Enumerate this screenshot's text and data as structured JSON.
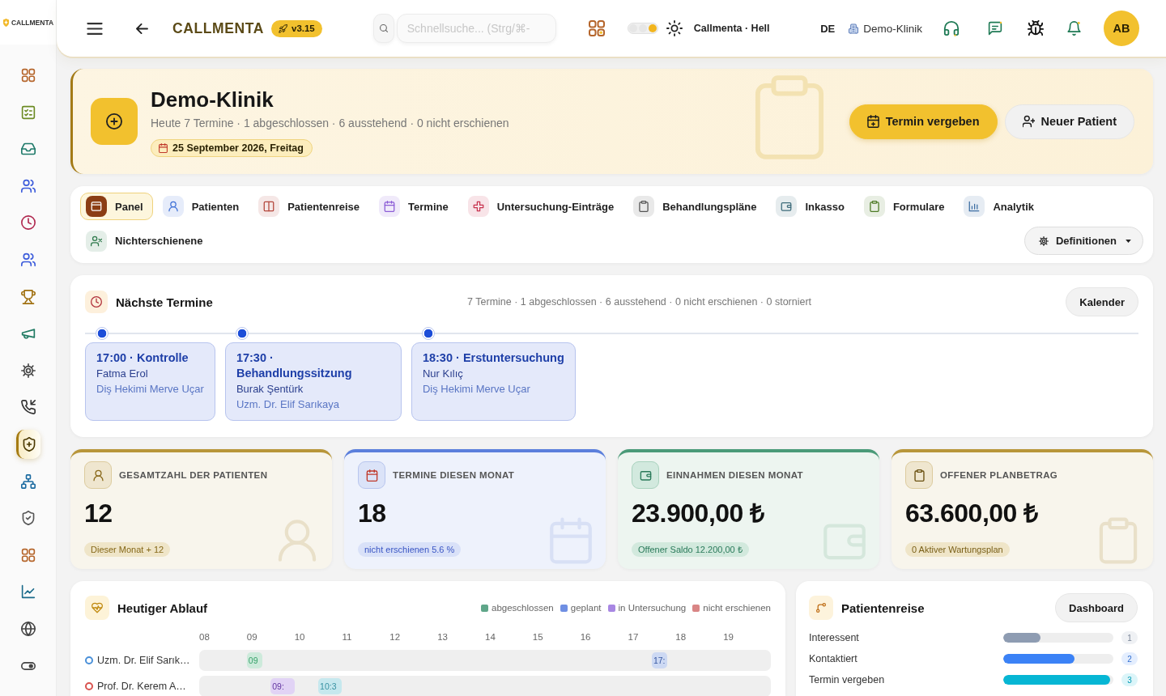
{
  "sidebar": {
    "logo": "CALLMENTA",
    "items": [
      {
        "selected": false
      },
      {
        "selected": false
      },
      {
        "selected": false
      },
      {
        "selected": false
      },
      {
        "selected": false
      },
      {
        "selected": false
      },
      {
        "selected": false
      },
      {
        "selected": false
      },
      {
        "selected": false
      },
      {
        "selected": false
      },
      {
        "selected": true
      },
      {
        "selected": false
      },
      {
        "selected": false
      },
      {
        "selected": false
      },
      {
        "selected": false
      },
      {
        "selected": false
      },
      {
        "selected": false
      }
    ]
  },
  "topbar": {
    "brand": "CALLMENTA",
    "version": "v3.15",
    "search": {
      "placeholder": "Schnellsuche... (Strg/⌘-"
    },
    "theme": {
      "label": "Callmenta · Hell",
      "options": [
        {
          "selected": false
        },
        {
          "selected": false
        },
        {
          "selected": true
        }
      ]
    },
    "language": "DE",
    "clinic": "Demo-Klinik",
    "avatar": "AB"
  },
  "header": {
    "title": "Demo-Klinik",
    "subtitle": "Heute 7 Termine · 1 abgeschlossen · 6 ausstehend · 0 nicht erschienen",
    "date": "25 September 2026, Freitag",
    "buttons": [
      {
        "label": "Termin vergeben",
        "kind": "primary"
      },
      {
        "label": "Neuer Patient",
        "kind": "secondary"
      }
    ]
  },
  "tabs": {
    "items": [
      {
        "label": "Panel",
        "selected": true
      },
      {
        "label": "Patienten",
        "selected": false
      },
      {
        "label": "Patientenreise",
        "selected": false
      },
      {
        "label": "Termine",
        "selected": false
      },
      {
        "label": "Untersuchung-Einträge",
        "selected": false
      },
      {
        "label": "Behandlungspläne",
        "selected": false
      },
      {
        "label": "Inkasso",
        "selected": false
      },
      {
        "label": "Formulare",
        "selected": false
      },
      {
        "label": "Analytik",
        "selected": false
      },
      {
        "label": "Nichterschienene",
        "selected": false
      }
    ],
    "dropdown": "Definitionen"
  },
  "upcoming": {
    "title": "Nächste Termine",
    "summary": "7 Termine · 1 abgeschlossen · 6 ausstehend · 0 nicht erschienen · 0 storniert",
    "button": "Kalender",
    "appointments": [
      {
        "title": "17:00 · Kontrolle",
        "patient": "Fatma Erol",
        "doctor": "Diş Hekimi Merve Uçar"
      },
      {
        "title": "17:30 · Behandlungssitzung",
        "patient": "Burak Şentürk",
        "doctor": "Uzm. Dr. Elif Sarıkaya"
      },
      {
        "title": "18:30 · Erstuntersuchung",
        "patient": "Nur Kılıç",
        "doctor": "Diş Hekimi Merve Uçar"
      }
    ]
  },
  "stats": [
    {
      "label": "GESAMTZAHL DER PATIENTEN",
      "value": "12",
      "note": "Dieser Monat + 12"
    },
    {
      "label": "TERMINE DIESEN MONAT",
      "value": "18",
      "note": "nicht erschienen 5.6 %"
    },
    {
      "label": "EINNAHMEN DIESEN MONAT",
      "value": "23.900,00 ₺",
      "note": "Offener Saldo 12.200,00 ₺"
    },
    {
      "label": "OFFENER PLANBETRAG",
      "value": "63.600,00 ₺",
      "note": "0 Aktiver Wartungsplan"
    }
  ],
  "schedule": {
    "title": "Heutiger Ablauf",
    "legend": [
      {
        "label": "abgeschlossen",
        "color": "#5fa689"
      },
      {
        "label": "geplant",
        "color": "#6f8fe3"
      },
      {
        "label": "in Untersuchung",
        "color": "#a887e3"
      },
      {
        "label": "nicht erschienen",
        "color": "#d98585"
      }
    ],
    "hours": [
      "08",
      "09",
      "10",
      "11",
      "12",
      "13",
      "14",
      "15",
      "16",
      "17",
      "18",
      "19"
    ],
    "rows": [
      {
        "name": "Uzm. Dr. Elif Sarık…",
        "color": "#4a90d9",
        "blocks": [
          {
            "label": "09",
            "color": "#cdeadb"
          },
          {
            "label": "17:",
            "color": "#cdd9f3"
          }
        ]
      },
      {
        "name": "Prof. Dr. Kerem A…",
        "color": "#d9534f",
        "blocks": [
          {
            "label": "09:",
            "color": "#e1d3f5"
          },
          {
            "label": "10:3",
            "color": "#c6e8ee"
          }
        ]
      }
    ]
  },
  "journey": {
    "title": "Patientenreise",
    "button": "Dashboard",
    "stages": [
      {
        "label": "Interessent",
        "level": 0.34,
        "count": "1",
        "color": "#8e9cb2"
      },
      {
        "label": "Kontaktiert",
        "level": 0.65,
        "count": "2",
        "color": "#3b82f6"
      },
      {
        "label": "Termin vergeben",
        "level": 0.97,
        "count": "3",
        "color": "#06b6d4"
      }
    ]
  }
}
